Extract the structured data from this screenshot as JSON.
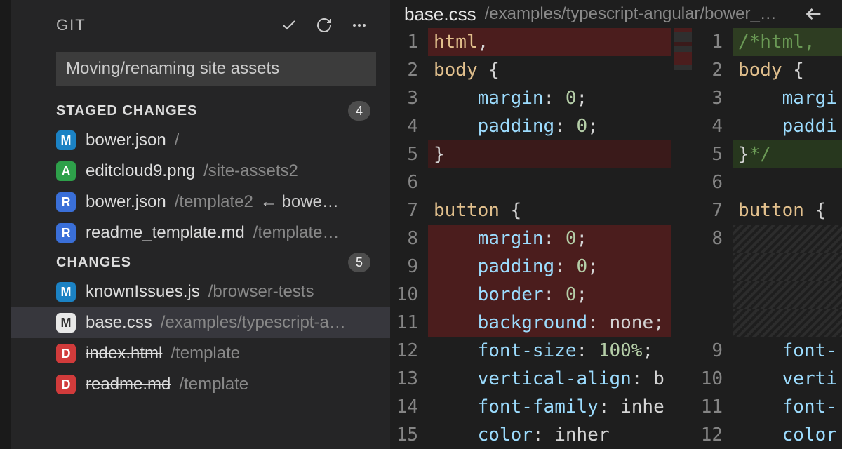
{
  "sidebar": {
    "title": "GIT",
    "commitMessage": "Moving/renaming site assets",
    "sections": [
      {
        "title": "STAGED CHANGES",
        "count": "4",
        "items": [
          {
            "status": "M",
            "chip": "chip-M-blue",
            "name": "bower.json",
            "path": "/",
            "extra": ""
          },
          {
            "status": "A",
            "chip": "chip-A",
            "name": "editcloud9.png",
            "path": "/site-assets2",
            "extra": ""
          },
          {
            "status": "R",
            "chip": "chip-R",
            "name": "bower.json",
            "path": "/template2",
            "extra": "← bowe…"
          },
          {
            "status": "R",
            "chip": "chip-R",
            "name": "readme_template.md",
            "path": "/template…",
            "extra": ""
          }
        ]
      },
      {
        "title": "CHANGES",
        "count": "5",
        "items": [
          {
            "status": "M",
            "chip": "chip-M-blue",
            "name": "knownIssues.js",
            "path": "/browser-tests",
            "extra": ""
          },
          {
            "status": "M",
            "chip": "chip-M-white",
            "name": "base.css",
            "path": "/examples/typescript-a…",
            "extra": "",
            "selected": true
          },
          {
            "status": "D",
            "chip": "chip-D",
            "name": "index.html",
            "path": "/template",
            "extra": "",
            "strike": true
          },
          {
            "status": "D",
            "chip": "chip-D",
            "name": "readme.md",
            "path": "/template",
            "extra": "",
            "strike": true
          }
        ]
      }
    ]
  },
  "editor": {
    "tab": {
      "name": "base.css",
      "path": "/examples/typescript-angular/bower_…"
    },
    "left": {
      "lines": [
        {
          "n": "1",
          "bg": "bg-del",
          "tokens": [
            [
              "tok-tag",
              "html"
            ],
            [
              "tok-punc",
              ","
            ]
          ]
        },
        {
          "n": "2",
          "tokens": [
            [
              "tok-tag",
              "body"
            ],
            [
              "tok-punc",
              " {"
            ]
          ]
        },
        {
          "n": "3",
          "tokens": [
            [
              "",
              "    "
            ],
            [
              "tok-prop",
              "margin"
            ],
            [
              "tok-punc",
              ": "
            ],
            [
              "tok-num",
              "0"
            ],
            [
              "tok-punc",
              ";"
            ]
          ]
        },
        {
          "n": "4",
          "tokens": [
            [
              "",
              "    "
            ],
            [
              "tok-prop",
              "padding"
            ],
            [
              "tok-punc",
              ": "
            ],
            [
              "tok-num",
              "0"
            ],
            [
              "tok-punc",
              ";"
            ]
          ]
        },
        {
          "n": "5",
          "bg": "bg-del-dark",
          "tokens": [
            [
              "tok-punc",
              "}"
            ]
          ]
        },
        {
          "n": "6",
          "tokens": []
        },
        {
          "n": "7",
          "tokens": [
            [
              "tok-tag",
              "button"
            ],
            [
              "tok-punc",
              " {"
            ]
          ]
        },
        {
          "n": "8",
          "bg": "bg-del",
          "tokens": [
            [
              "",
              "    "
            ],
            [
              "tok-prop",
              "margin"
            ],
            [
              "tok-punc",
              ": "
            ],
            [
              "tok-num",
              "0"
            ],
            [
              "tok-punc",
              ";"
            ]
          ]
        },
        {
          "n": "9",
          "bg": "bg-del",
          "tokens": [
            [
              "",
              "    "
            ],
            [
              "tok-prop",
              "padding"
            ],
            [
              "tok-punc",
              ": "
            ],
            [
              "tok-num",
              "0"
            ],
            [
              "tok-punc",
              ";"
            ]
          ]
        },
        {
          "n": "10",
          "bg": "bg-del",
          "tokens": [
            [
              "",
              "    "
            ],
            [
              "tok-prop",
              "border"
            ],
            [
              "tok-punc",
              ": "
            ],
            [
              "tok-num",
              "0"
            ],
            [
              "tok-punc",
              ";"
            ]
          ]
        },
        {
          "n": "11",
          "bg": "bg-del",
          "tokens": [
            [
              "",
              "    "
            ],
            [
              "tok-prop",
              "background"
            ],
            [
              "tok-punc",
              ": "
            ],
            [
              "tok-val",
              "none"
            ],
            [
              "tok-punc",
              ";"
            ]
          ]
        },
        {
          "n": "12",
          "tokens": [
            [
              "",
              "    "
            ],
            [
              "tok-prop",
              "font-size"
            ],
            [
              "tok-punc",
              ": "
            ],
            [
              "tok-num",
              "100%"
            ],
            [
              "tok-punc",
              ";"
            ]
          ]
        },
        {
          "n": "13",
          "tokens": [
            [
              "",
              "    "
            ],
            [
              "tok-prop",
              "vertical-align"
            ],
            [
              "tok-punc",
              ": "
            ],
            [
              "tok-val",
              "b"
            ]
          ]
        },
        {
          "n": "14",
          "tokens": [
            [
              "",
              "    "
            ],
            [
              "tok-prop",
              "font-family"
            ],
            [
              "tok-punc",
              ": "
            ],
            [
              "tok-val",
              "inhe"
            ]
          ]
        },
        {
          "n": "15",
          "tokens": [
            [
              "",
              "    "
            ],
            [
              "tok-prop",
              "color"
            ],
            [
              "tok-punc",
              ": "
            ],
            [
              "tok-val",
              "inher"
            ]
          ]
        }
      ]
    },
    "right": {
      "lines": [
        {
          "n": "1",
          "bg": "bg-add-b",
          "tokens": [
            [
              "tok-cmt",
              "/*html,"
            ]
          ]
        },
        {
          "n": "2",
          "tokens": [
            [
              "tok-tag",
              "body"
            ],
            [
              "tok-punc",
              " {"
            ]
          ]
        },
        {
          "n": "3",
          "tokens": [
            [
              "",
              "    "
            ],
            [
              "tok-prop",
              "margi"
            ]
          ]
        },
        {
          "n": "4",
          "tokens": [
            [
              "",
              "    "
            ],
            [
              "tok-prop",
              "paddi"
            ]
          ]
        },
        {
          "n": "5",
          "bg": "bg-add",
          "tokens": [
            [
              "tok-punc",
              "}"
            ],
            [
              "tok-cmt",
              "*/"
            ]
          ]
        },
        {
          "n": "6",
          "tokens": []
        },
        {
          "n": "7",
          "tokens": [
            [
              "tok-tag",
              "button"
            ],
            [
              "tok-punc",
              " {"
            ]
          ]
        },
        {
          "n": "8",
          "bg": "hatch",
          "tokens": []
        },
        {
          "n": "",
          "bg": "hatch",
          "tokens": []
        },
        {
          "n": "",
          "bg": "hatch",
          "tokens": []
        },
        {
          "n": "",
          "bg": "hatch",
          "tokens": []
        },
        {
          "n": "9",
          "tokens": [
            [
              "",
              "    "
            ],
            [
              "tok-prop",
              "font-"
            ]
          ]
        },
        {
          "n": "10",
          "tokens": [
            [
              "",
              "    "
            ],
            [
              "tok-prop",
              "verti"
            ]
          ]
        },
        {
          "n": "11",
          "tokens": [
            [
              "",
              "    "
            ],
            [
              "tok-prop",
              "font-"
            ]
          ]
        },
        {
          "n": "12",
          "tokens": [
            [
              "",
              "    "
            ],
            [
              "tok-prop",
              "color"
            ]
          ]
        }
      ]
    }
  }
}
